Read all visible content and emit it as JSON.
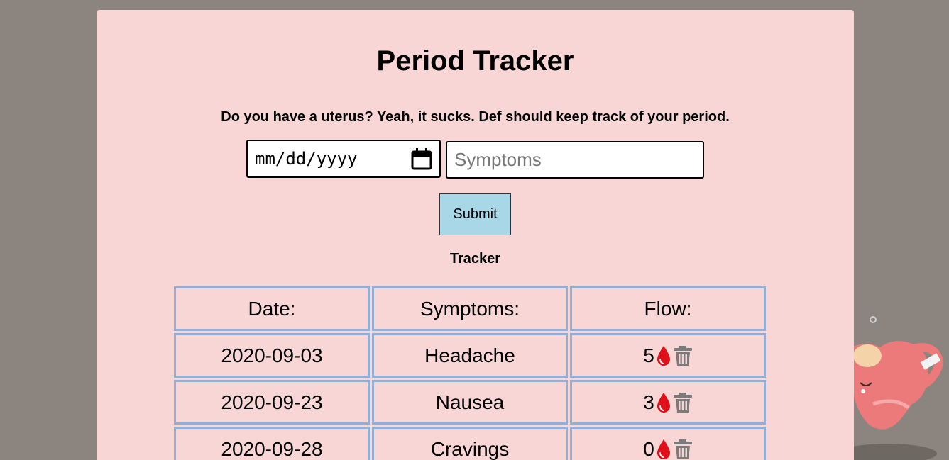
{
  "header": {
    "title": "Period Tracker",
    "tagline": "Do you have a uterus? Yeah, it sucks. Def should keep track of your period."
  },
  "form": {
    "date_placeholder": "mm/dd/yyyy",
    "symptoms_placeholder": "Symptoms",
    "submit_label": "Submit"
  },
  "tracker": {
    "label": "Tracker",
    "columns": [
      "Date:",
      "Symptoms:",
      "Flow:"
    ],
    "rows": [
      {
        "date": "2020-09-03",
        "symptoms": "Headache",
        "flow": "5"
      },
      {
        "date": "2020-09-23",
        "symptoms": "Nausea",
        "flow": "3"
      },
      {
        "date": "2020-09-28",
        "symptoms": "Cravings",
        "flow": "0"
      }
    ]
  },
  "icons": {
    "calendar": "calendar-icon",
    "flow": "blood-drop-icon",
    "delete": "trash-icon",
    "mascot": "uterus-mascot"
  },
  "colors": {
    "page_background": "#8c847e",
    "card_background": "#f9d6d6",
    "table_border": "#94add3",
    "submit_background": "#a8d8e8",
    "drop": "#e0101a",
    "trash": "#7a7a7a"
  }
}
